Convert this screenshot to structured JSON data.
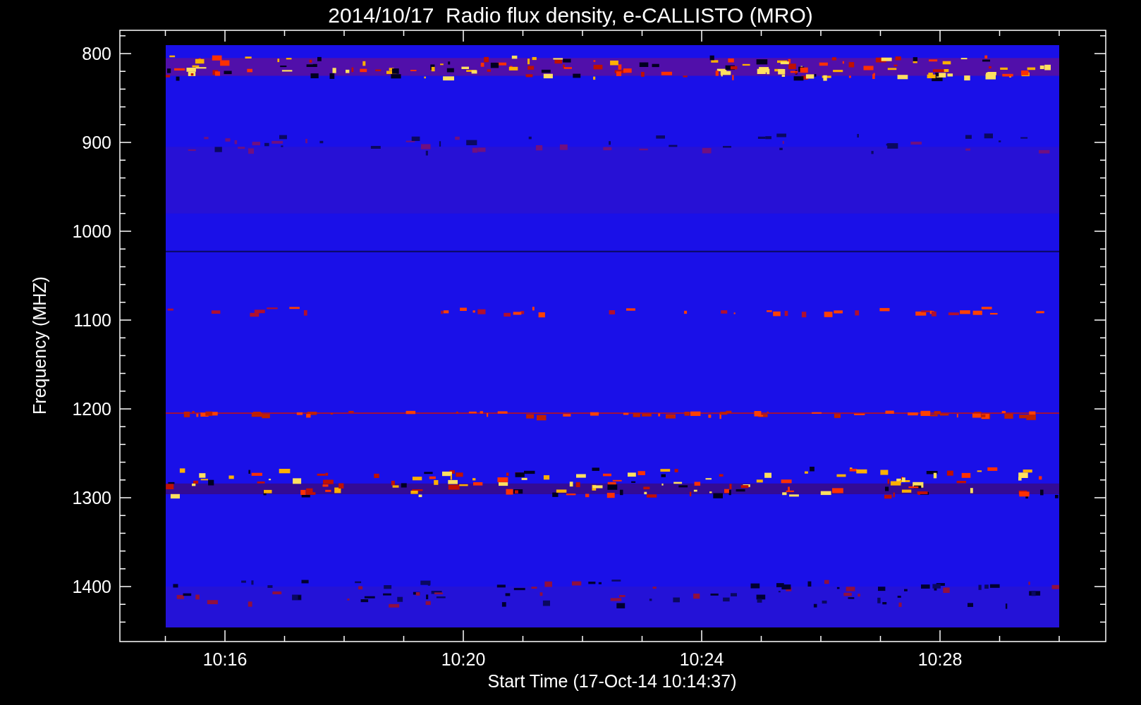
{
  "title": "2014/10/17  Radio flux density, e-CALLISTO (MRO)",
  "y_axis": {
    "label": "Frequency (MHZ)",
    "ticks": [
      "800",
      "900",
      "1000",
      "1100",
      "1200",
      "1300",
      "1400"
    ]
  },
  "x_axis": {
    "label": "Start Time (17-Oct-14 10:14:37)",
    "ticks": [
      "10:16",
      "10:20",
      "10:24",
      "10:28"
    ]
  }
}
